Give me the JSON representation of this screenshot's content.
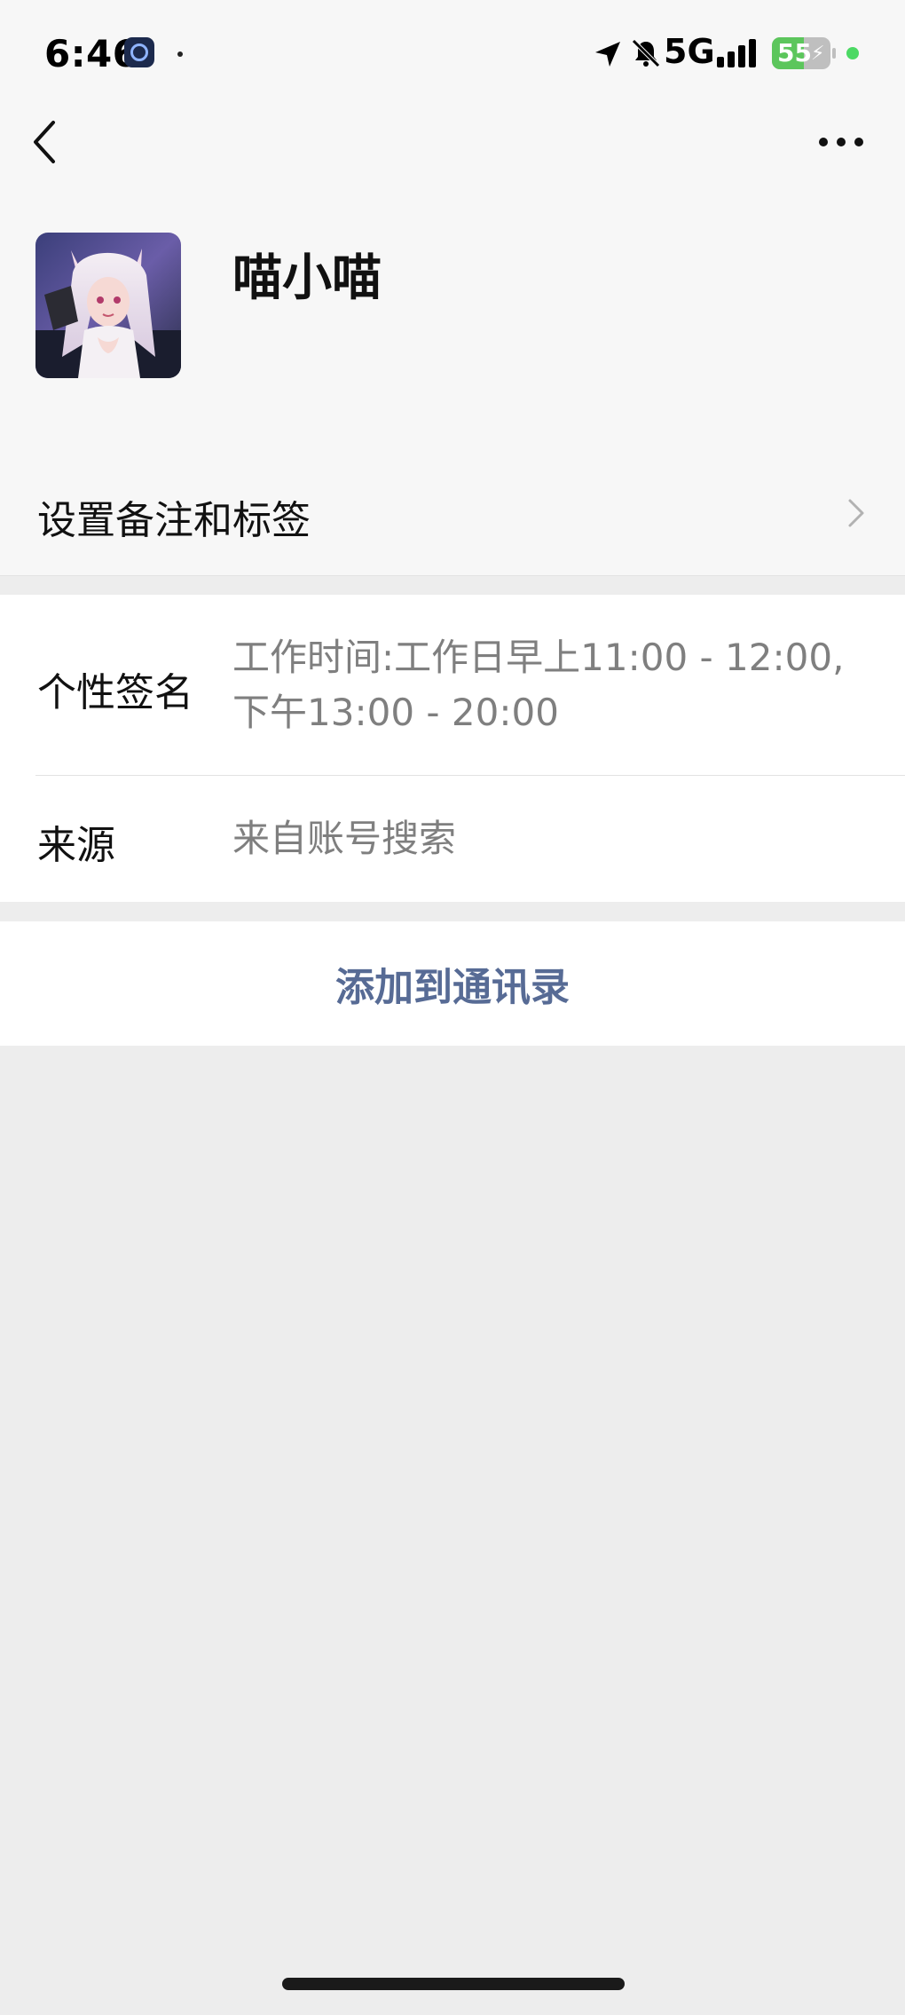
{
  "status_bar": {
    "time": "6:46",
    "network": "5G",
    "battery": "55",
    "battery_level": 0.55,
    "icons": [
      "app-indicator-icon",
      "location-arrow-icon",
      "bell-muted-icon",
      "signal-bars-icon",
      "battery-charging-icon"
    ]
  },
  "nav": {
    "back_icon": "chevron-left-icon",
    "more_icon": "ellipsis-icon"
  },
  "profile": {
    "name": "喵小喵",
    "avatar": "avatar-image"
  },
  "rows": {
    "remark_label": "设置备注和标签",
    "signature_label": "个性签名",
    "signature_line1": "工作时间:工作日早上11:00 - 12:00,",
    "signature_line2": "下午13:00 - 20:00",
    "source_label": "来源",
    "source_value": "来自账号搜索"
  },
  "actions": {
    "add_contact": "添加到通讯录"
  },
  "colors": {
    "link": "#576b95",
    "background": "#ededed",
    "battery_fill": "#5cc65c"
  }
}
